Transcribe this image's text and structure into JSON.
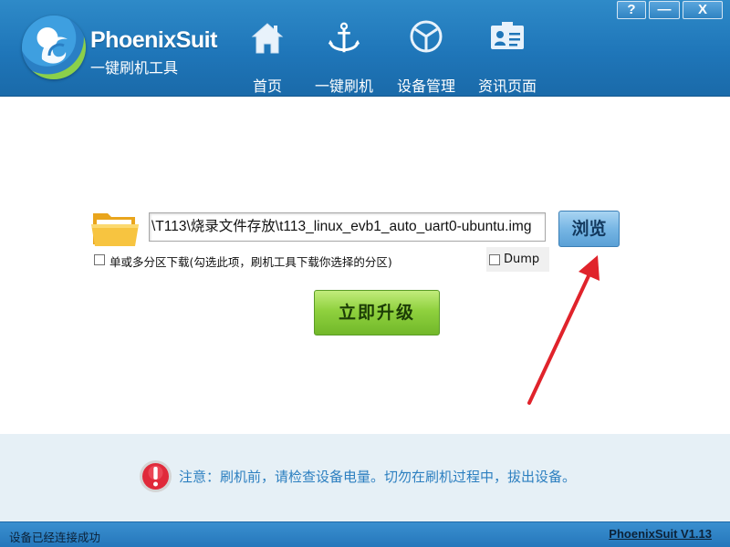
{
  "app": {
    "name": "PhoenixSuit",
    "subtitle": "一键刷机工具"
  },
  "window_buttons": {
    "help": "?",
    "minimize": "—",
    "close": "X"
  },
  "nav": [
    {
      "label": "首页",
      "icon": "home-icon"
    },
    {
      "label": "一键刷机",
      "icon": "anchor-icon"
    },
    {
      "label": "设备管理",
      "icon": "cube-icon"
    },
    {
      "label": "资讯页面",
      "icon": "news-icon"
    }
  ],
  "flash": {
    "image_path": "\\T113\\烧录文件存放\\t113_linux_evb1_auto_uart0-ubuntu.img",
    "browse_label": "浏览",
    "multi_partition_label": "单或多分区下载(勾选此项，刷机工具下载你选择的分区)",
    "dump_label": "Dump",
    "upgrade_label": "立即升级"
  },
  "notice": {
    "text": "注意：刷机前，请检查设备电量。切勿在刷机过程中，拔出设备。"
  },
  "status": {
    "left": "设备已经连接成功",
    "right": "PhoenixSuit V1.13"
  },
  "colors": {
    "header_blue": "#1f76b9",
    "notice_text": "#2c7fc0",
    "upgrade_green": "#8fd13e",
    "arrow_red": "#e0232b"
  }
}
